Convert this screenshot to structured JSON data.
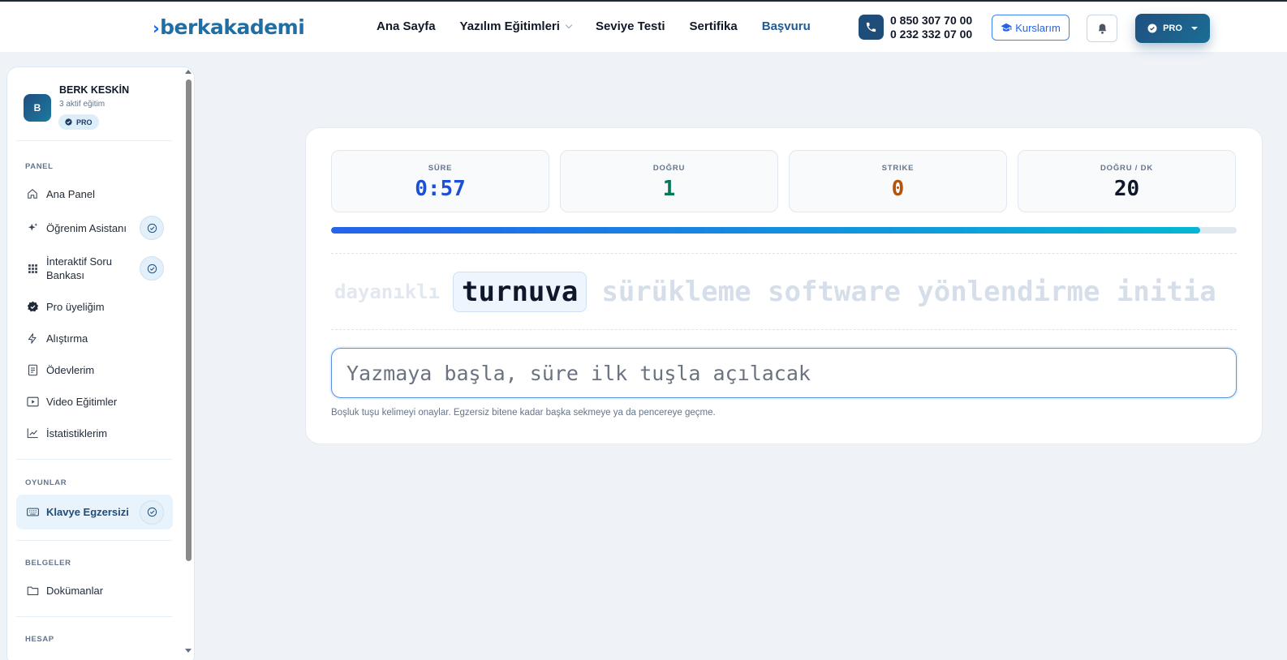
{
  "header": {
    "logo_mark": "›",
    "logo_text": "berkakademi",
    "nav": [
      {
        "label": "Ana Sayfa"
      },
      {
        "label": "Yazılım Eğitimleri"
      },
      {
        "label": "Seviye Testi"
      },
      {
        "label": "Sertifika"
      },
      {
        "label": "Başvuru"
      }
    ],
    "phone_1": "0 850 307 70 00",
    "phone_2": "0 232 332 07 00",
    "courses_label": "Kurslarım",
    "pro_label": "PRO",
    "brand_color": "#1e4d7a",
    "accent_color": "#2563eb"
  },
  "sidebar": {
    "user": {
      "initial": "B",
      "name": "BERK KESKİN",
      "subtitle": "3 aktif eğitim",
      "badge": "PRO"
    },
    "sections": {
      "panel": "PANEL",
      "games": "OYUNLAR",
      "docs": "BELGELER",
      "account": "HESAP"
    },
    "items": [
      {
        "label": "Ana Panel",
        "icon": "home-icon"
      },
      {
        "label": "Öğrenim Asistanı",
        "icon": "sparkle-icon"
      },
      {
        "label": "İnteraktif Soru Bankası",
        "icon": "grid-icon"
      },
      {
        "label": "Pro üyeliğim",
        "icon": "verified-badge-icon"
      },
      {
        "label": "Alıştırma",
        "icon": "lightning-icon"
      },
      {
        "label": "Ödevlerim",
        "icon": "document-list-icon"
      },
      {
        "label": "Video Eğitimler",
        "icon": "play-icon"
      },
      {
        "label": "İstatistiklerim",
        "icon": "chart-icon"
      },
      {
        "label": "Klavye Egzersizi",
        "icon": "keyboard-icon"
      },
      {
        "label": "Dokümanlar",
        "icon": "folder-icon"
      }
    ]
  },
  "typing": {
    "stats": [
      {
        "label": "SÜRE",
        "value": "0:57",
        "color": "#1d4ed8"
      },
      {
        "label": "DOĞRU",
        "value": "1",
        "color": "#047857"
      },
      {
        "label": "STRIKE",
        "value": "0",
        "color": "#b45309"
      },
      {
        "label": "DOĞRU / DK",
        "value": "20",
        "color": "#0f172a"
      }
    ],
    "progress_percent": 96,
    "previous_word": "dayanıklı",
    "current_word": "turnuva",
    "upcoming_words": "sürükleme software yönlendirme initia",
    "input_placeholder": "Yazmaya başla, süre ilk tuşla açılacak",
    "hint": "Boşluk tuşu kelimeyi onaylar. Egzersiz bitene kadar başka sekmeye ya da pencereye geçme."
  }
}
